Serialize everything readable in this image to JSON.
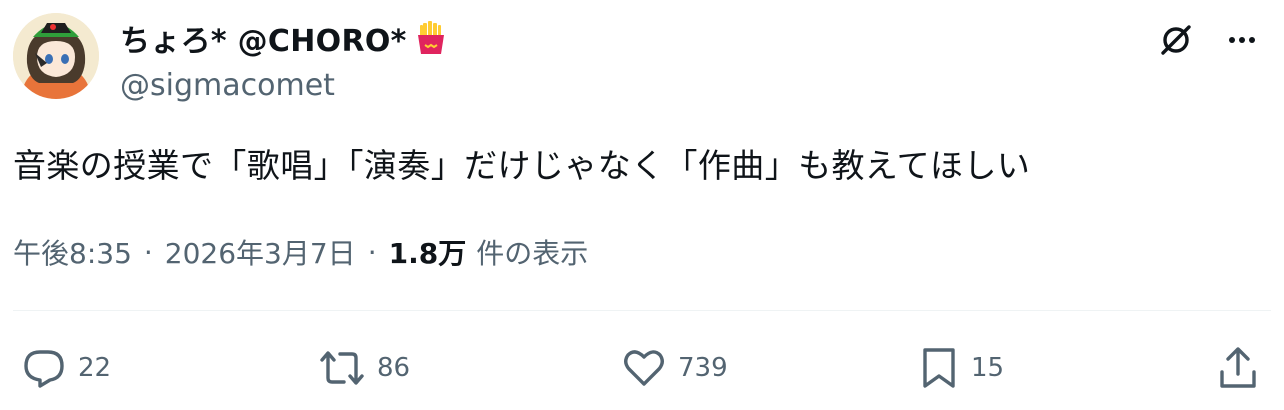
{
  "author": {
    "display_name": "ちょろ* @CHORO*",
    "handle": "@sigmacomet",
    "badge_icon": "fries-icon",
    "avatar_icon": "avatar-character"
  },
  "header_actions": {
    "grok_icon": "grok-icon",
    "more_label": "···"
  },
  "tweet": {
    "text": "音楽の授業で「歌唱」「演奏」だけじゃなく「作曲」も教えてほしい"
  },
  "meta": {
    "time": "午後8:35",
    "separator": "·",
    "date": "2026年3月7日",
    "views_count": "1.8万",
    "views_label": "件の表示"
  },
  "actions": {
    "reply_count": "22",
    "retweet_count": "86",
    "like_count": "739",
    "bookmark_count": "15",
    "share_icon": "share-icon"
  },
  "colors": {
    "text_primary": "#0f1419",
    "text_secondary": "#536471",
    "divider": "#eff3f4",
    "badge_red": "#e0245e",
    "fries_yellow": "#ffcc33"
  }
}
